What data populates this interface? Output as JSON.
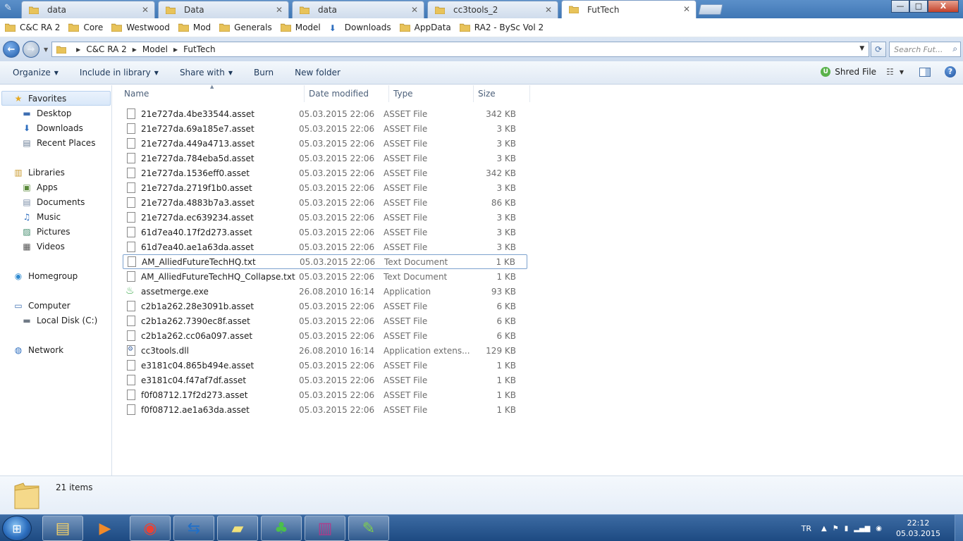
{
  "tabs": [
    {
      "label": "data",
      "active": false
    },
    {
      "label": "Data",
      "active": false
    },
    {
      "label": "data",
      "active": false
    },
    {
      "label": "cc3tools_2",
      "active": false
    },
    {
      "label": "FutTech",
      "active": true
    }
  ],
  "tab_close_glyph": "✕",
  "window_controls": {
    "minimize": "—",
    "maximize": "□",
    "close": "X"
  },
  "bookmarks": [
    "C&C RA 2",
    "Core",
    "Westwood",
    "Mod",
    "Generals",
    "Model",
    "Downloads",
    "AppData",
    "RA2 - BySc Vol 2"
  ],
  "address": {
    "crumbs": [
      "C&C RA 2",
      "Model",
      "FutTech"
    ]
  },
  "search": {
    "placeholder": "Search Fut..."
  },
  "toolbar": {
    "organize": "Organize",
    "include_in_library": "Include in library",
    "share_with": "Share with",
    "burn": "Burn",
    "new_folder": "New folder",
    "shred_file": "Shred File"
  },
  "nav": {
    "favorites": "Favorites",
    "favorites_items": [
      "Desktop",
      "Downloads",
      "Recent Places"
    ],
    "libraries": "Libraries",
    "libraries_items": [
      "Apps",
      "Documents",
      "Music",
      "Pictures",
      "Videos"
    ],
    "homegroup": "Homegroup",
    "computer": "Computer",
    "computer_items": [
      "Local Disk (C:)"
    ],
    "network": "Network"
  },
  "columns": {
    "name": "Name",
    "date_modified": "Date modified",
    "type": "Type",
    "size": "Size"
  },
  "files": [
    {
      "name": "21e727da.4be33544.asset",
      "date": "05.03.2015 22:06",
      "type": "ASSET File",
      "size": "342 KB",
      "icon": "file-icon"
    },
    {
      "name": "21e727da.69a185e7.asset",
      "date": "05.03.2015 22:06",
      "type": "ASSET File",
      "size": "3 KB",
      "icon": "file-icon"
    },
    {
      "name": "21e727da.449a4713.asset",
      "date": "05.03.2015 22:06",
      "type": "ASSET File",
      "size": "3 KB",
      "icon": "file-icon"
    },
    {
      "name": "21e727da.784eba5d.asset",
      "date": "05.03.2015 22:06",
      "type": "ASSET File",
      "size": "3 KB",
      "icon": "file-icon"
    },
    {
      "name": "21e727da.1536eff0.asset",
      "date": "05.03.2015 22:06",
      "type": "ASSET File",
      "size": "342 KB",
      "icon": "file-icon"
    },
    {
      "name": "21e727da.2719f1b0.asset",
      "date": "05.03.2015 22:06",
      "type": "ASSET File",
      "size": "3 KB",
      "icon": "file-icon"
    },
    {
      "name": "21e727da.4883b7a3.asset",
      "date": "05.03.2015 22:06",
      "type": "ASSET File",
      "size": "86 KB",
      "icon": "file-icon"
    },
    {
      "name": "21e727da.ec639234.asset",
      "date": "05.03.2015 22:06",
      "type": "ASSET File",
      "size": "3 KB",
      "icon": "file-icon"
    },
    {
      "name": "61d7ea40.17f2d273.asset",
      "date": "05.03.2015 22:06",
      "type": "ASSET File",
      "size": "3 KB",
      "icon": "file-icon"
    },
    {
      "name": "61d7ea40.ae1a63da.asset",
      "date": "05.03.2015 22:06",
      "type": "ASSET File",
      "size": "3 KB",
      "icon": "file-icon"
    },
    {
      "name": "AM_AlliedFutureTechHQ.txt",
      "date": "05.03.2015 22:06",
      "type": "Text Document",
      "size": "1 KB",
      "icon": "text-file-icon",
      "highlight": true
    },
    {
      "name": "AM_AlliedFutureTechHQ_Collapse.txt",
      "date": "05.03.2015 22:06",
      "type": "Text Document",
      "size": "1 KB",
      "icon": "text-file-icon"
    },
    {
      "name": "assetmerge.exe",
      "date": "26.08.2010 16:14",
      "type": "Application",
      "size": "93 KB",
      "icon": "exe-icon"
    },
    {
      "name": "c2b1a262.28e3091b.asset",
      "date": "05.03.2015 22:06",
      "type": "ASSET File",
      "size": "6 KB",
      "icon": "file-icon"
    },
    {
      "name": "c2b1a262.7390ec8f.asset",
      "date": "05.03.2015 22:06",
      "type": "ASSET File",
      "size": "6 KB",
      "icon": "file-icon"
    },
    {
      "name": "c2b1a262.cc06a097.asset",
      "date": "05.03.2015 22:06",
      "type": "ASSET File",
      "size": "6 KB",
      "icon": "file-icon"
    },
    {
      "name": "cc3tools.dll",
      "date": "26.08.2010 16:14",
      "type": "Application extens...",
      "size": "129 KB",
      "icon": "dll-icon"
    },
    {
      "name": "e3181c04.865b494e.asset",
      "date": "05.03.2015 22:06",
      "type": "ASSET File",
      "size": "1 KB",
      "icon": "file-icon"
    },
    {
      "name": "e3181c04.f47af7df.asset",
      "date": "05.03.2015 22:06",
      "type": "ASSET File",
      "size": "1 KB",
      "icon": "file-icon"
    },
    {
      "name": "f0f08712.17f2d273.asset",
      "date": "05.03.2015 22:06",
      "type": "ASSET File",
      "size": "1 KB",
      "icon": "file-icon"
    },
    {
      "name": "f0f08712.ae1a63da.asset",
      "date": "05.03.2015 22:06",
      "type": "ASSET File",
      "size": "1 KB",
      "icon": "file-icon"
    }
  ],
  "status": {
    "item_count": "21 items"
  },
  "taskbar": {
    "apps": [
      {
        "icon": "explorer-icon",
        "running": true
      },
      {
        "icon": "media-player-icon",
        "running": false
      },
      {
        "icon": "chrome-icon",
        "running": true
      },
      {
        "icon": "teamviewer-icon",
        "running": true
      },
      {
        "icon": "sticky-notes-icon",
        "running": true
      },
      {
        "icon": "clover-icon",
        "running": true
      },
      {
        "icon": "winrar-icon",
        "running": true
      },
      {
        "icon": "notepad-plus-plus-icon",
        "running": true
      }
    ],
    "language": "TR",
    "clock_time": "22:12",
    "clock_date": "05.03.2015"
  },
  "colors": {
    "titlebar": "#3f77b5",
    "selection_border": "#7da2ce",
    "taskbar": "#1d4a82"
  }
}
